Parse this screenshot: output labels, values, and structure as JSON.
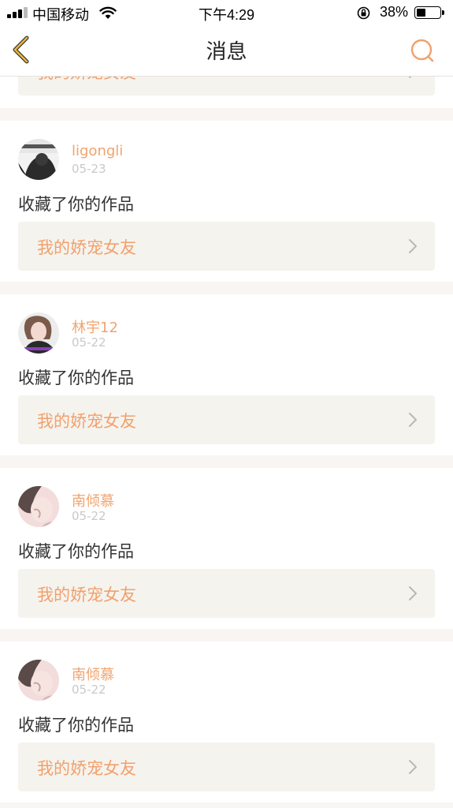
{
  "status_bar": {
    "carrier": "中国移动",
    "time": "下午4:29",
    "battery": "38%"
  },
  "nav": {
    "title": "消息",
    "back_icon": "chevron-left-icon",
    "search_icon": "search-icon"
  },
  "partial_top_card": {
    "work_title": "我的娇宠女友"
  },
  "messages": [
    {
      "username": "ligongli",
      "date": "05-23",
      "action": "收藏了你的作品",
      "work_title": "我的娇宠女友"
    },
    {
      "username": "林宇12",
      "date": "05-22",
      "action": "收藏了你的作品",
      "work_title": "我的娇宠女友"
    },
    {
      "username": "南倾慕",
      "date": "05-22",
      "action": "收藏了你的作品",
      "work_title": "我的娇宠女友"
    },
    {
      "username": "南倾慕",
      "date": "05-22",
      "action": "收藏了你的作品",
      "work_title": "我的娇宠女友"
    }
  ],
  "colors": {
    "accent": "#f2a06c",
    "username": "#f0a46e",
    "link_bg": "#f5f3ee",
    "page_bg": "#f9f5f2",
    "back_icon": "#e8b43c"
  }
}
